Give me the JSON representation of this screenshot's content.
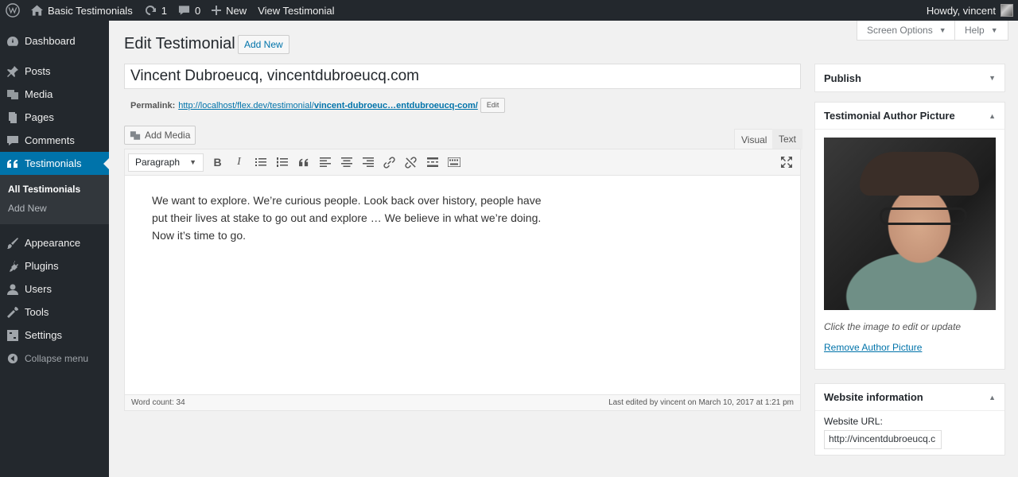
{
  "adminbar": {
    "site_name": "Basic Testimonials",
    "updates_count": "1",
    "comments_count": "0",
    "new_label": "New",
    "view_label": "View Testimonial",
    "greeting": "Howdy, vincent"
  },
  "sidebar": {
    "items": [
      {
        "label": "Dashboard"
      },
      {
        "label": "Posts"
      },
      {
        "label": "Media"
      },
      {
        "label": "Pages"
      },
      {
        "label": "Comments"
      },
      {
        "label": "Testimonials"
      },
      {
        "label": "Appearance"
      },
      {
        "label": "Plugins"
      },
      {
        "label": "Users"
      },
      {
        "label": "Tools"
      },
      {
        "label": "Settings"
      }
    ],
    "submenu": [
      "All Testimonials",
      "Add New"
    ],
    "collapse_label": "Collapse menu"
  },
  "header": {
    "title": "Edit Testimonial",
    "add_new": "Add New",
    "screen_options": "Screen Options",
    "help": "Help"
  },
  "post": {
    "title": "Vincent Dubroeucq, vincentdubroeucq.com",
    "permalink_label": "Permalink:",
    "permalink_base": "http://localhost/flex.dev/testimonial/",
    "permalink_slug": "vincent-dubroeuc…entdubroeucq-com/",
    "permalink_edit": "Edit"
  },
  "editor": {
    "add_media": "Add Media",
    "tab_visual": "Visual",
    "tab_text": "Text",
    "format": "Paragraph",
    "content_lines": [
      "We want to explore. We’re curious people. Look back over history, people have",
      "put their lives at stake to go out and explore … We believe in what we’re doing.",
      "Now it’s time to go."
    ],
    "word_count": "Word count: 34",
    "last_edited": "Last edited by vincent on March 10, 2017 at 1:21 pm"
  },
  "publish": {
    "title": "Publish"
  },
  "author_picture": {
    "title": "Testimonial Author Picture",
    "note": "Click the image to edit or update",
    "remove_link": "Remove Author Picture"
  },
  "website": {
    "title": "Website information",
    "url_label": "Website URL:",
    "url_value": "http://vincentdubroeucq.c"
  },
  "colors": {
    "admin_dark": "#23282d",
    "accent": "#0073aa",
    "background": "#f1f1f1"
  }
}
